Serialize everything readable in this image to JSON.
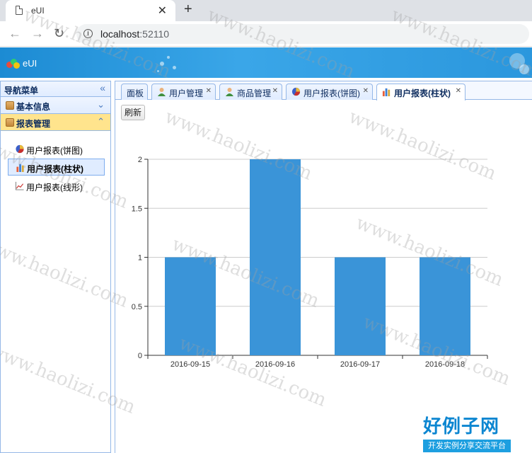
{
  "browser": {
    "tab_title": "eUI",
    "url_host": "localhost",
    "url_port": ":52110"
  },
  "app": {
    "name": "eUI"
  },
  "sidebar": {
    "header": "导航菜单",
    "groups": [
      {
        "label": "基本信息"
      },
      {
        "label": "报表管理"
      }
    ],
    "items": [
      {
        "label": "用户报表(饼图)",
        "icon": "pie-chart-icon"
      },
      {
        "label": "用户报表(柱状)",
        "icon": "bar-chart-icon"
      },
      {
        "label": "用户报表(线形)",
        "icon": "line-chart-icon"
      }
    ]
  },
  "tabs": [
    {
      "label": "面板"
    },
    {
      "label": "用户管理",
      "icon": "user-icon"
    },
    {
      "label": "商品管理",
      "icon": "user-icon"
    },
    {
      "label": "用户报表(饼图)",
      "icon": "pie-chart-icon"
    },
    {
      "label": "用户报表(柱状)",
      "icon": "bar-chart-icon"
    }
  ],
  "content": {
    "refresh_label": "刷新"
  },
  "chart_data": {
    "type": "bar",
    "categories": [
      "2016-09-15",
      "2016-09-16",
      "2016-09-17",
      "2016-09-18"
    ],
    "values": [
      1,
      2,
      1,
      1
    ],
    "y_ticks": [
      "0",
      "0.5",
      "1",
      "1.5",
      "2"
    ],
    "ylim": [
      0,
      2
    ],
    "grid": true,
    "bar_color": "#3a94d8"
  },
  "watermark": {
    "text": "www.haolizi.com",
    "brand_title": "好例子网",
    "brand_subtitle": "开发实例分享交流平台"
  },
  "colors": {
    "header_blue": "#2b97dd",
    "panel_border": "#95b8e7",
    "active_group": "#ffe48d"
  }
}
